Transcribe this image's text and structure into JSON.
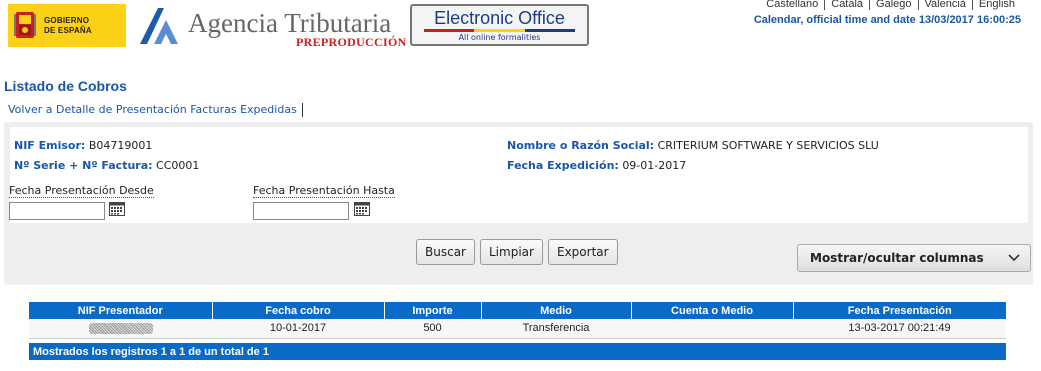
{
  "header": {
    "gov_logo_text": [
      "GOBIERNO",
      "DE ESPAÑA"
    ],
    "agency_name": "Agencia Tributaria",
    "environment_label": "PREPRODUCCIÓN",
    "electronic_office": {
      "title": "Electronic Office",
      "subtitle": "All online formalities"
    },
    "languages": [
      "Castellano",
      "Català",
      "Galego",
      "Valencià",
      "English"
    ],
    "calendar_link": "Calendar, official time and date 13/03/2017 16:00:25",
    "colors": {
      "brand_blue": "#1a56a8",
      "gov_yellow": "#fcd116",
      "env_red": "#c8201c"
    }
  },
  "page": {
    "title": "Listado de Cobros",
    "back_link": "Volver a Detalle de Presentación Facturas Expedidas"
  },
  "invoice": {
    "nif_emisor_label": "NIF Emisor:",
    "nif_emisor": "B04719001",
    "razon_social_label": "Nombre o Razón Social:",
    "razon_social": "CRITERIUM SOFTWARE Y SERVICIOS SLU",
    "serie_factura_label": "Nº Serie + Nº Factura:",
    "serie_factura": "CC0001",
    "fecha_expedicion_label": "Fecha Expedición:",
    "fecha_expedicion": "09-01-2017"
  },
  "filters": {
    "fecha_desde_label": "Fecha Presentación Desde",
    "fecha_desde_value": "",
    "fecha_hasta_label": "Fecha Presentación Hasta",
    "fecha_hasta_value": ""
  },
  "actions": {
    "buscar": "Buscar",
    "limpiar": "Limpiar",
    "exportar": "Exportar",
    "toggle_columns": "Mostrar/ocultar columnas"
  },
  "table": {
    "headers": [
      "NIF Presentador",
      "Fecha cobro",
      "Importe",
      "Medio",
      "Cuenta o Medio",
      "Fecha Presentación"
    ],
    "rows": [
      {
        "nif_presentador": "",
        "fecha_cobro": "10-01-2017",
        "importe": "500",
        "medio": "Transferencia",
        "cuenta_o_medio": "",
        "fecha_presentacion": "13-03-2017 00:21:49"
      }
    ],
    "footer": "Mostrados los registros 1 a 1 de un total de 1",
    "header_color": "#0a6ac8"
  }
}
